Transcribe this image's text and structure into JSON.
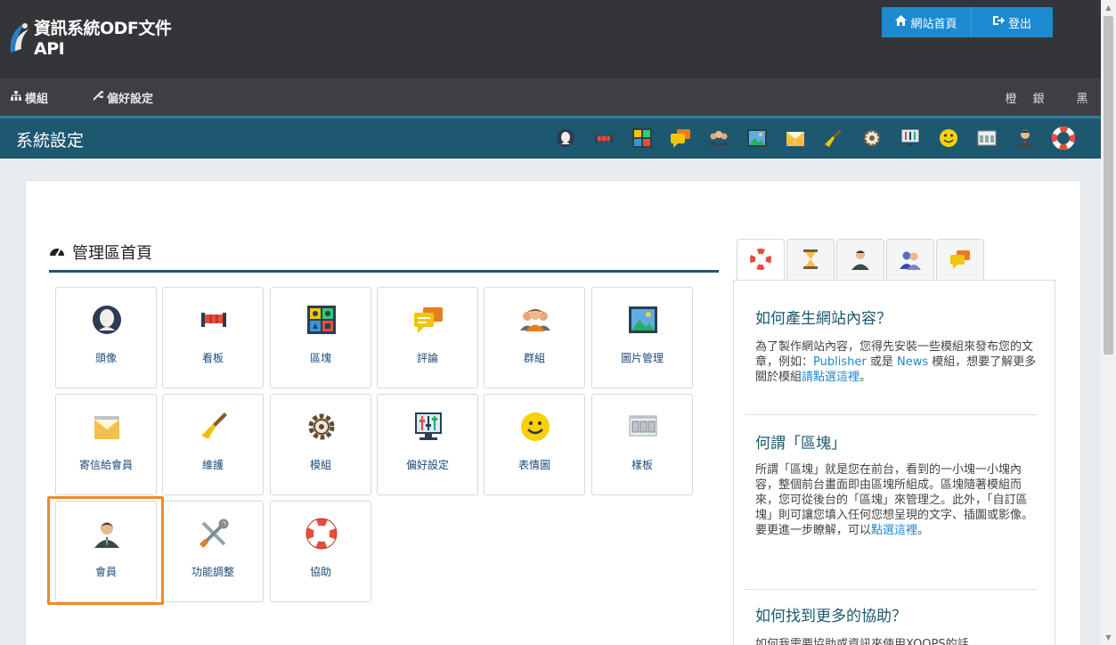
{
  "header": {
    "site_title": "資訊系統ODF文件API",
    "home_button": "網站首頁",
    "logout_button": "登出"
  },
  "menu": {
    "modules": "模組",
    "preferences": "偏好設定",
    "themes": [
      "橙",
      "銀",
      "黑"
    ]
  },
  "titlebar": {
    "title": "系統設定",
    "icons": [
      "avatar-icon",
      "banner-icon",
      "blocks-icon",
      "comments-icon",
      "groups-icon",
      "images-icon",
      "mail-icon",
      "maintenance-icon",
      "gear-icon",
      "preferences-icon",
      "smiley-icon",
      "templates-icon",
      "user-icon",
      "lifebuoy-icon"
    ]
  },
  "main": {
    "section_title": "管理區首頁",
    "tiles": [
      {
        "label": "頭像",
        "icon": "avatar-icon"
      },
      {
        "label": "看板",
        "icon": "banner-icon"
      },
      {
        "label": "區塊",
        "icon": "blocks-icon"
      },
      {
        "label": "評論",
        "icon": "comments-icon"
      },
      {
        "label": "群組",
        "icon": "groups-icon"
      },
      {
        "label": "圖片管理",
        "icon": "images-icon"
      },
      {
        "label": "寄信給會員",
        "icon": "mail-icon"
      },
      {
        "label": "維護",
        "icon": "broom-icon"
      },
      {
        "label": "模組",
        "icon": "gear-icon"
      },
      {
        "label": "偏好設定",
        "icon": "preferences-icon"
      },
      {
        "label": "表情圖",
        "icon": "smiley-icon"
      },
      {
        "label": "樣板",
        "icon": "templates-icon"
      },
      {
        "label": "會員",
        "icon": "user-icon"
      },
      {
        "label": "功能調整",
        "icon": "tools-icon"
      },
      {
        "label": "協助",
        "icon": "lifebuoy-icon"
      }
    ]
  },
  "help": {
    "tabs": [
      "lifebuoy-icon",
      "hourglass-icon",
      "user-icon",
      "users-icon",
      "comments-icon"
    ],
    "q1": "如何產生網站內容？",
    "p1_a": "為了製作網站內容，您得先安裝一些模組來發布您的文章，例如：",
    "p1_link1": "Publisher",
    "p1_b": " 或是 ",
    "p1_link2": "News",
    "p1_c": " 模組，想要了解更多關於模組",
    "p1_link3": "請點選這裡",
    "p1_d": "。",
    "q2": "何謂「區塊」",
    "p2_a": "所謂「區塊」就是您在前台，看到的一小塊一小塊內容，整個前台畫面即由區塊所組成。區塊隨著模組而來，您可從後台的「區塊」來管理之。此外，「自訂區塊」則可讓您填入任何您想呈現的文字、插圖或影像。要更進一步瞭解，可以",
    "p2_link": "點選這裡",
    "p2_b": "。",
    "q3": "如何找到更多的協助？",
    "p3": "如何我需要協助或資訊來使用XOOPS的話，"
  },
  "colors": {
    "topbar": "#333538",
    "titlebar": "#1e5870",
    "accent_blue": "#1c8ad1",
    "highlight": "#f08a24"
  }
}
